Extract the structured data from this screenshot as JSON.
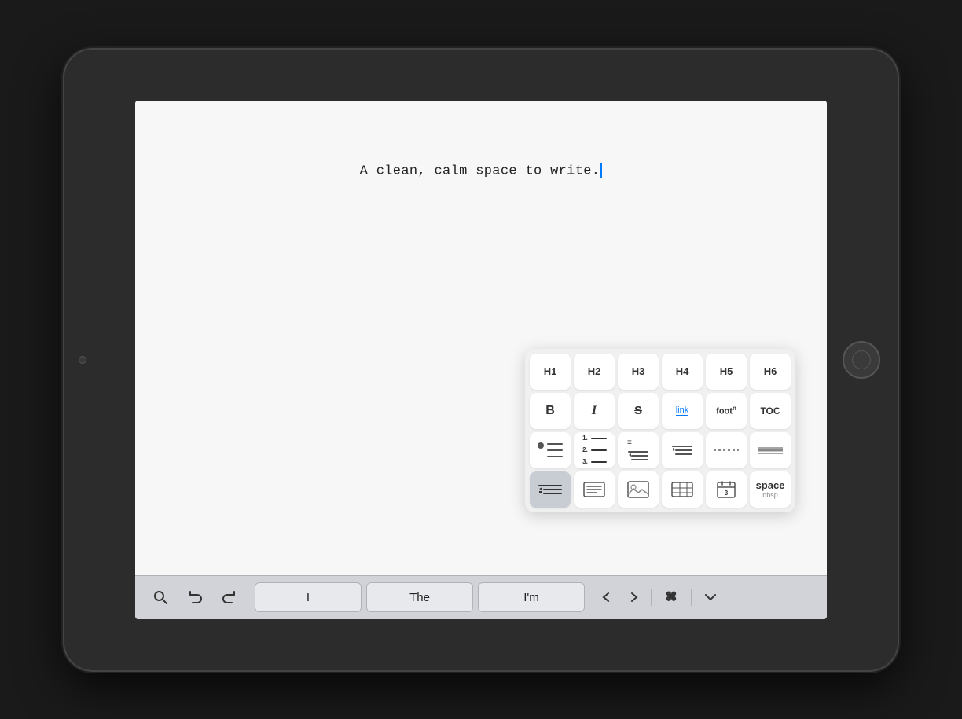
{
  "tablet": {
    "writing_content": "A clean, calm space to write.",
    "cursor_visible": true
  },
  "format_toolbar": {
    "rows": [
      [
        {
          "id": "h1",
          "label": "H1",
          "style": "normal"
        },
        {
          "id": "h2",
          "label": "H2",
          "style": "normal"
        },
        {
          "id": "h3",
          "label": "H3",
          "style": "normal"
        },
        {
          "id": "h4",
          "label": "H4",
          "style": "normal"
        },
        {
          "id": "h5",
          "label": "H5",
          "style": "normal"
        },
        {
          "id": "h6",
          "label": "H6",
          "style": "normal"
        }
      ],
      [
        {
          "id": "bold",
          "label": "B",
          "style": "bold"
        },
        {
          "id": "italic",
          "label": "I",
          "style": "italic"
        },
        {
          "id": "strikethrough",
          "label": "S",
          "style": "strike"
        },
        {
          "id": "link",
          "label": "link",
          "style": "link"
        },
        {
          "id": "footnote",
          "label": "footⁿ",
          "style": "footnote"
        },
        {
          "id": "toc",
          "label": "TOC",
          "style": "normal"
        }
      ],
      [
        {
          "id": "unordered-list",
          "label": "",
          "style": "ul-icon"
        },
        {
          "id": "ordered-list",
          "label": "",
          "style": "ol-icon"
        },
        {
          "id": "indent",
          "label": "",
          "style": "indent-icon"
        },
        {
          "id": "dedent",
          "label": "",
          "style": "dedent-icon"
        },
        {
          "id": "hr-dotted",
          "label": "",
          "style": "hr-dotted"
        },
        {
          "id": "hr-solid",
          "label": "",
          "style": "hr-solid"
        }
      ],
      [
        {
          "id": "reduce-indent",
          "label": "",
          "style": "reduce-indent",
          "active": true
        },
        {
          "id": "text-block",
          "label": "",
          "style": "text-block"
        },
        {
          "id": "image",
          "label": "",
          "style": "image"
        },
        {
          "id": "table",
          "label": "",
          "style": "table"
        },
        {
          "id": "calendar",
          "label": "3",
          "style": "calendar"
        },
        {
          "id": "space",
          "label": "space",
          "sublabel": "nbsp",
          "style": "space"
        }
      ]
    ]
  },
  "bottom_toolbar": {
    "search_icon": "🔍",
    "undo_icon": "↩",
    "redo_icon": "↪",
    "suggestions": [
      "I",
      "The",
      "I'm"
    ],
    "prev_icon": "<",
    "next_icon": ">",
    "cmd_icon": "⌘",
    "collapse_icon": "⌄"
  }
}
